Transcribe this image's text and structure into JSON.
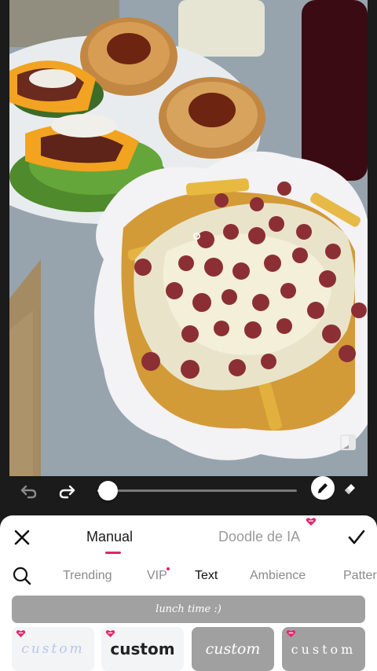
{
  "toolbar": {
    "undo_icon": "undo-icon",
    "redo_icon": "redo-icon",
    "brush_size_fraction": 0.05,
    "pen_icon": "pen-icon",
    "eraser_icon": "eraser-icon"
  },
  "panel": {
    "modes": [
      "Manual",
      "Doodle de IA"
    ],
    "active_mode": "Manual",
    "categories": [
      "Trending",
      "VIP",
      "Text",
      "Ambience",
      "Pattern"
    ],
    "active_category": "Text",
    "text_preview": "lunch time :)",
    "styles": [
      {
        "label": "custom",
        "vip": true
      },
      {
        "label": "custom",
        "vip": true
      },
      {
        "label": "custom",
        "vip": false
      },
      {
        "label": "custom",
        "vip": true
      }
    ]
  },
  "colors": {
    "accent": "#e0245e",
    "panel_bg": "#ffffff",
    "toolbar_bg": "#1b1b1b"
  }
}
